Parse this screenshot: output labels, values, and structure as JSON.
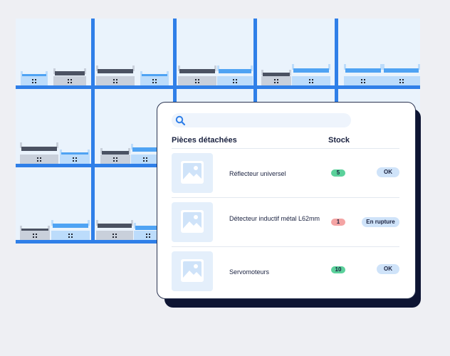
{
  "search": {
    "value": "",
    "placeholder": ""
  },
  "table": {
    "headers": {
      "name": "Pièces détachées",
      "stock": "Stock"
    },
    "rows": [
      {
        "name": "Réflecteur universel",
        "qty": "5",
        "status": "OK",
        "qty_color": "#5bd19b"
      },
      {
        "name": "Détecteur inductif métal L62mm",
        "qty": "1",
        "status": "En rupture",
        "qty_color": "#f4a4a4"
      },
      {
        "name": "Servomoteurs",
        "qty": "10",
        "status": "OK",
        "qty_color": "#5bd19b"
      }
    ]
  },
  "colors": {
    "rack_blue": "#2f7fe8",
    "panel_shadow": "#0e1533",
    "status_badge": "#cfe3f9"
  },
  "icons": {
    "search": "search-icon",
    "thumbnail": "image-placeholder-icon"
  }
}
